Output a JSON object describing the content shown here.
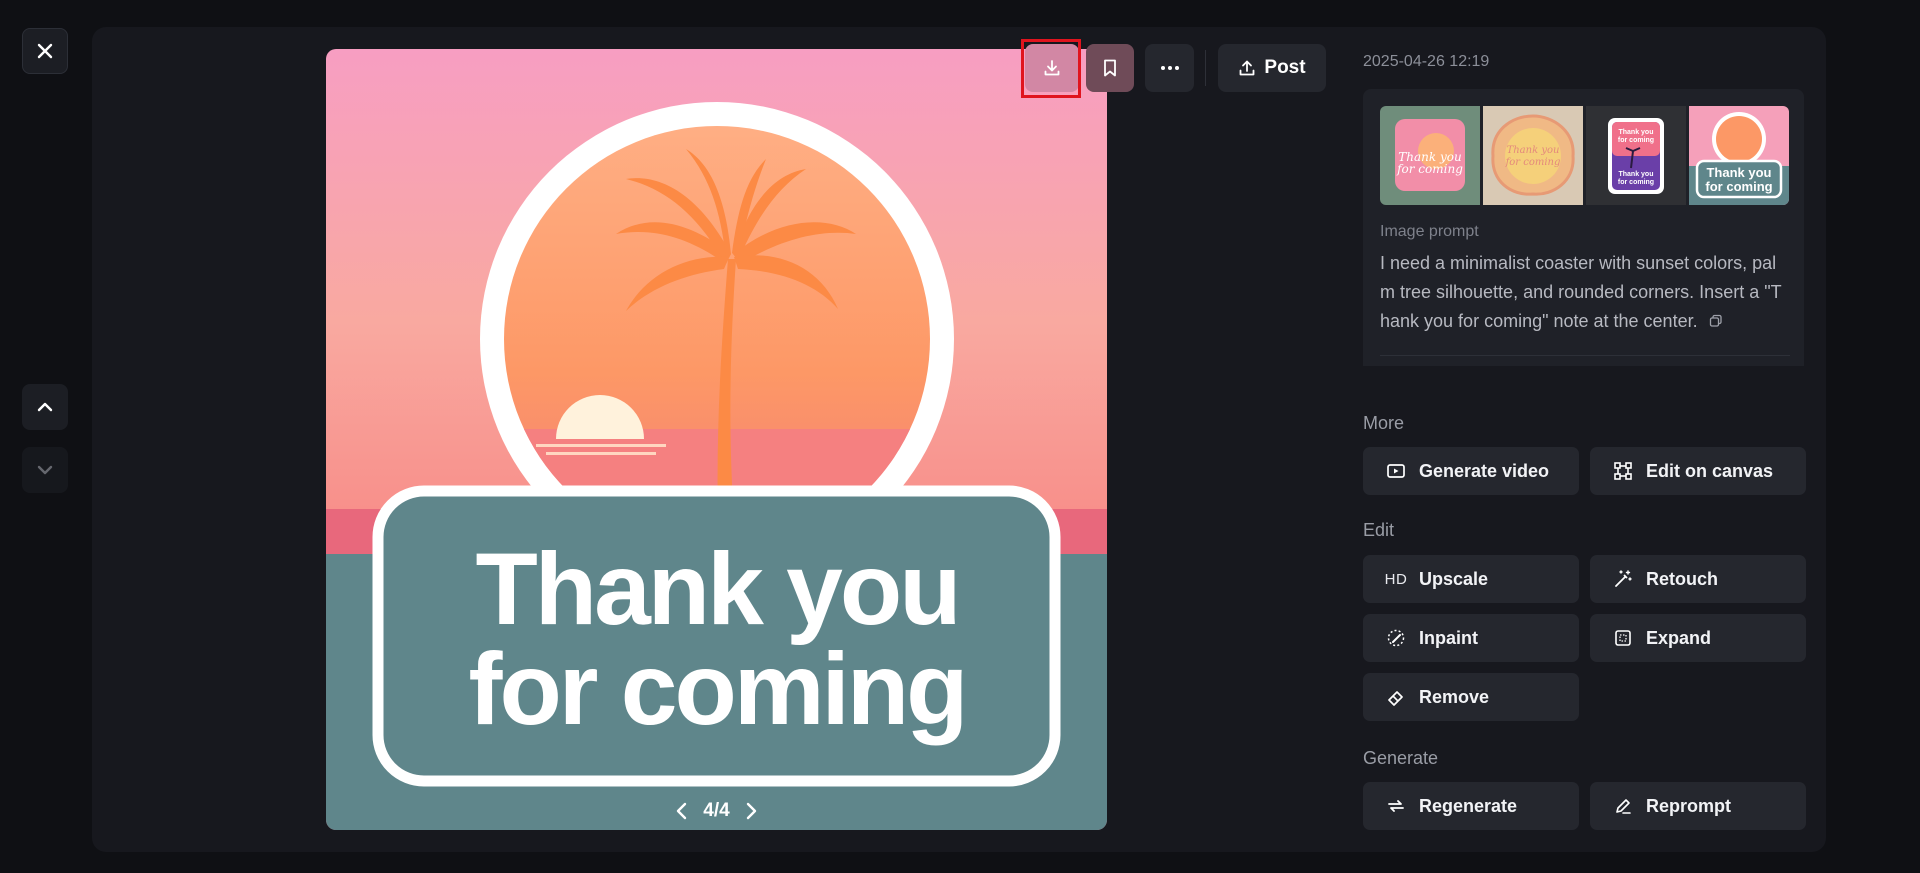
{
  "viewer": {
    "close_icon": "close-icon",
    "nav_up_icon": "chevron-up-icon",
    "nav_down_icon": "chevron-down-icon"
  },
  "image": {
    "headline_line1": "Thank you",
    "headline_line2": "for coming",
    "pager": "4/4"
  },
  "toolbar": {
    "download_icon": "download-icon",
    "bookmark_icon": "bookmark-icon",
    "more_icon": "more-icon",
    "post_label": "Post"
  },
  "details": {
    "timestamp": "2025-04-26 12:19",
    "thumbnails": [
      {
        "line1": "Thank you",
        "line2": "for coming"
      },
      {
        "line1": "Thank you",
        "line2": "for coming"
      },
      {
        "line1": "Thank you",
        "line2": "for coming"
      },
      {
        "line1": "Thank you",
        "line2": "for coming"
      }
    ],
    "prompt_label": "Image prompt",
    "prompt_text": "I need a minimalist coaster with sunset colors, palm tree silhouette, and rounded corners. Insert a \"Thank you for coming\" note at the center."
  },
  "sections": {
    "more": {
      "title": "More",
      "generate_video": "Generate video",
      "edit_on_canvas": "Edit on canvas"
    },
    "edit": {
      "title": "Edit",
      "upscale_badge": "HD",
      "upscale": "Upscale",
      "retouch": "Retouch",
      "inpaint": "Inpaint",
      "expand": "Expand",
      "remove": "Remove"
    },
    "generate": {
      "title": "Generate",
      "regenerate": "Regenerate",
      "reprompt": "Reprompt"
    }
  },
  "colors": {
    "accent_pink": "#d287a4",
    "sunset_orange": "#fb8c4c",
    "teal_panel": "#5f868b"
  }
}
